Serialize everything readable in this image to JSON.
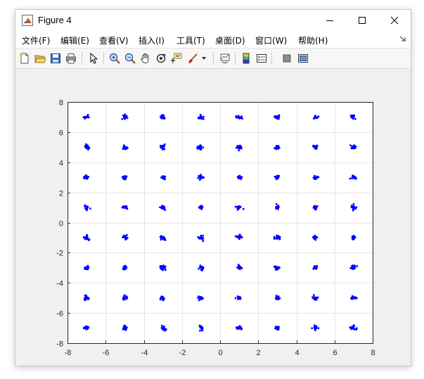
{
  "window": {
    "title": "Figure 4",
    "icon": "matlab-logo-icon",
    "controls": [
      "minimize-icon",
      "maximize-icon",
      "close-icon"
    ]
  },
  "menu": {
    "items": [
      {
        "label": "文件(F)"
      },
      {
        "label": "编辑(E)"
      },
      {
        "label": "查看(V)"
      },
      {
        "label": "插入(I)"
      },
      {
        "label": "工具(T)"
      },
      {
        "label": "桌面(D)"
      },
      {
        "label": "窗口(W)"
      },
      {
        "label": "帮助(H)"
      }
    ]
  },
  "toolbar": {
    "buttons": [
      "new-figure-icon",
      "open-file-icon",
      "save-icon",
      "print-icon",
      "pointer-icon",
      "zoom-in-icon",
      "zoom-out-icon",
      "pan-hand-icon",
      "rotate-3d-icon",
      "data-cursor-icon",
      "brush-icon",
      "link-plot-icon",
      "colorbar-icon",
      "legend-icon",
      "hide-plot-tools-icon",
      "show-plot-tools-icon"
    ]
  },
  "chart_data": {
    "type": "scatter",
    "title": "",
    "xlabel": "",
    "ylabel": "",
    "xlim": [
      -8,
      8
    ],
    "ylim": [
      -8,
      8
    ],
    "xticks": [
      -8,
      -6,
      -4,
      -2,
      0,
      2,
      4,
      6,
      8
    ],
    "yticks": [
      -8,
      -6,
      -4,
      -2,
      0,
      2,
      4,
      6,
      8
    ],
    "grid": true,
    "marker_color": "#0000ff",
    "series": [
      {
        "description": "64-QAM constellation clusters",
        "centers_x": [
          -7,
          -5,
          -3,
          -1,
          1,
          3,
          5,
          7
        ],
        "centers_y": [
          -7,
          -5,
          -3,
          -1,
          1,
          3,
          5,
          7
        ],
        "spread": 0.12
      }
    ]
  }
}
